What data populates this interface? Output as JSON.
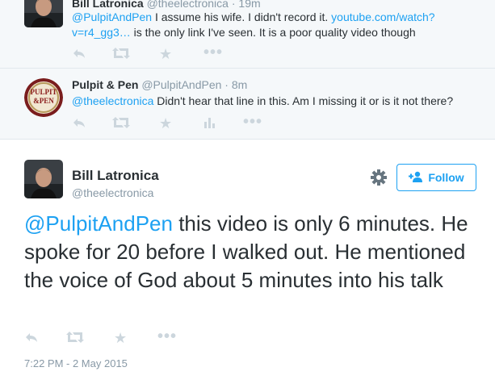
{
  "reply1": {
    "name": "Bill Latronica",
    "handle": "@theelectronica",
    "time": "· 19m",
    "mention": "@PulpitAndPen",
    "text_before_link": " I assume his wife. I didn't record it. ",
    "link": "youtube.com/watch?v=r4_gg3…",
    "text_after_link": " is the only link I've seen. It is a poor quality video though"
  },
  "reply2": {
    "name": "Pulpit & Pen",
    "handle": "@PulpitAndPen",
    "time": "· 8m",
    "mention": "@theelectronica",
    "text": " Didn't hear that line in this. Am I missing it or is it not there?",
    "avatar_text_top": "PULPIT",
    "avatar_text_mid": "&PEN"
  },
  "main": {
    "name": "Bill Latronica",
    "handle": "@theelectronica",
    "follow_label": "Follow",
    "mention": "@PulpitAndPen",
    "text": " this video is only 6 minutes. He spoke for 20 before I walked out. He mentioned the voice of God about 5 minutes into his talk",
    "timestamp": "7:22 PM - 2 May 2015"
  },
  "icons": {
    "reply": "reply-icon",
    "retweet": "retweet-icon",
    "favorite": "star-icon",
    "analytics": "analytics-icon",
    "more": "more-icon",
    "gear": "gear-icon",
    "follow": "add-user-icon"
  },
  "colors": {
    "link": "#1da1f2",
    "reply_background": "#f5f8fa",
    "handle": "#8899a6",
    "action_icon": "#ccd6dd"
  }
}
